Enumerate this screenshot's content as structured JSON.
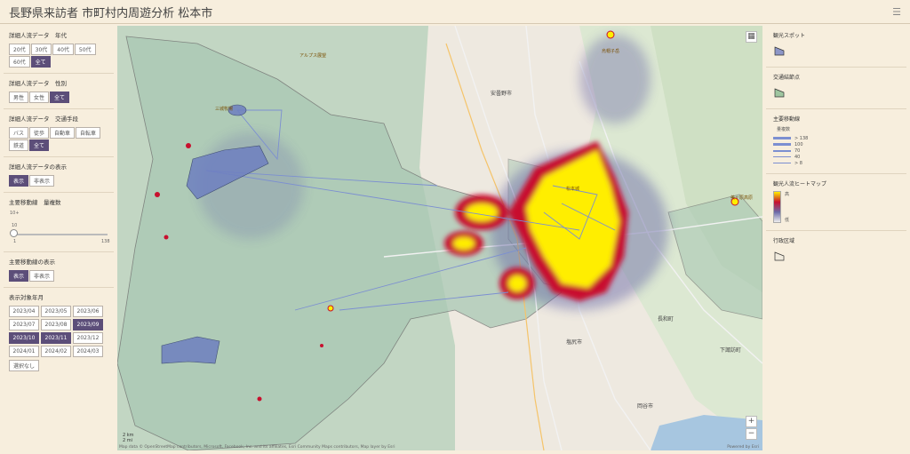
{
  "app": {
    "title": "長野県来訪者 市町村内周遊分析 松本市"
  },
  "filters": {
    "age": {
      "title": "詳細人流データ　年代",
      "options": [
        "20代",
        "30代",
        "40代",
        "50代",
        "60代",
        "全て"
      ],
      "selected": "全て"
    },
    "gender": {
      "title": "詳細人流データ　性別",
      "options": [
        "男性",
        "女性",
        "全て"
      ],
      "selected": "全て"
    },
    "transport": {
      "title": "詳細人流データ　交通手段",
      "options": [
        "バス",
        "徒歩",
        "自動車",
        "自転車",
        "鉄道",
        "全て"
      ],
      "selected": "全て"
    },
    "detail_display": {
      "title": "詳細人流データの表示",
      "options": [
        "表示",
        "非表示"
      ],
      "selected": "表示"
    },
    "route_volume": {
      "title": "主要移動線　量複数",
      "min_label": "10+",
      "value_label": "10",
      "tick_min": "1",
      "tick_max": "138",
      "value": 10
    },
    "route_display": {
      "title": "主要移動線の表示",
      "options": [
        "表示",
        "非表示"
      ],
      "selected": "表示"
    },
    "period": {
      "title": "表示対象年月",
      "options": [
        "2023/04",
        "2023/05",
        "2023/06",
        "2023/07",
        "2023/08",
        "2023/09",
        "2023/10",
        "2023/11",
        "2023/12",
        "2024/01",
        "2024/02",
        "2024/03"
      ],
      "selected": [
        "2023/09",
        "2023/10",
        "2023/11"
      ],
      "clear_label": "選択なし"
    }
  },
  "legend": {
    "spots": {
      "title": "観光スポット"
    },
    "transit": {
      "title": "交通結節点"
    },
    "routes": {
      "title": "主要移動線",
      "subtitle": "量複数",
      "items": [
        "> 138",
        "100",
        "70",
        "40",
        "> 8"
      ]
    },
    "heatmap": {
      "title": "観光人流ヒートマップ",
      "high": "高",
      "low": "低"
    },
    "admin": {
      "title": "行政区域"
    }
  },
  "map": {
    "labels": {
      "azumino": "安曇野市",
      "omachi": "大町市",
      "shiojiri": "塩尻市",
      "okaya": "岡谷市",
      "suwa": "諏訪市",
      "nagawa": "長和町",
      "shimosuwa": "下諏訪町",
      "spot1": "アルプス展望",
      "spot2": "烏帽子岳",
      "spot3": "三城牧場",
      "spot4": "松本城",
      "spot5": "美ヶ原高原"
    },
    "scale_km": "2 km",
    "scale_mi": "2 mi",
    "attribution": "Map data © OpenStreetMap contributors, Microsoft, Facebook, Inc. and its affiliates, Esri Community Maps contributors, Map layer by Esri",
    "powered": "Powered by Esri"
  },
  "colors": {
    "accent": "#5c4e79",
    "heat_high": "#ffee00",
    "heat_mid": "#c8102e",
    "heat_low": "#6b6aa8",
    "route": "#7c8fd1",
    "admin_fill": "#b5d1bf"
  }
}
